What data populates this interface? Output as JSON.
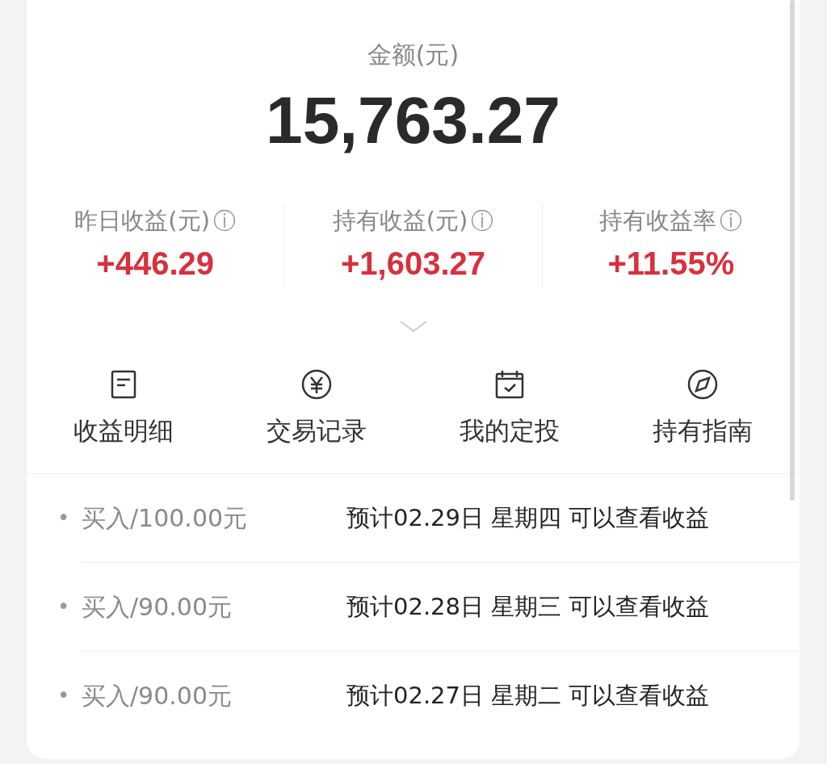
{
  "amount": {
    "label": "金额(元)",
    "value": "15,763.27"
  },
  "stats": [
    {
      "label": "昨日收益(元)",
      "info": "ⓘ",
      "value": "+446.29"
    },
    {
      "label": "持有收益(元)",
      "info": "ⓘ",
      "value": "+1,603.27"
    },
    {
      "label": "持有收益率",
      "info": "ⓘ",
      "value": "+11.55%"
    }
  ],
  "actions": [
    {
      "kind": "document",
      "label": "收益明细"
    },
    {
      "kind": "yen",
      "label": "交易记录"
    },
    {
      "kind": "calendar",
      "label": "我的定投"
    },
    {
      "kind": "compass",
      "label": "持有指南"
    }
  ],
  "records": [
    {
      "bullet": "•",
      "purchase": "买入/100.00元",
      "note": "预计02.29日 星期四 可以查看收益"
    },
    {
      "bullet": "•",
      "purchase": "买入/90.00元",
      "note": "预计02.28日 星期三 可以查看收益"
    },
    {
      "bullet": "•",
      "purchase": "买入/90.00元",
      "note": "预计02.27日 星期二 可以查看收益"
    }
  ]
}
